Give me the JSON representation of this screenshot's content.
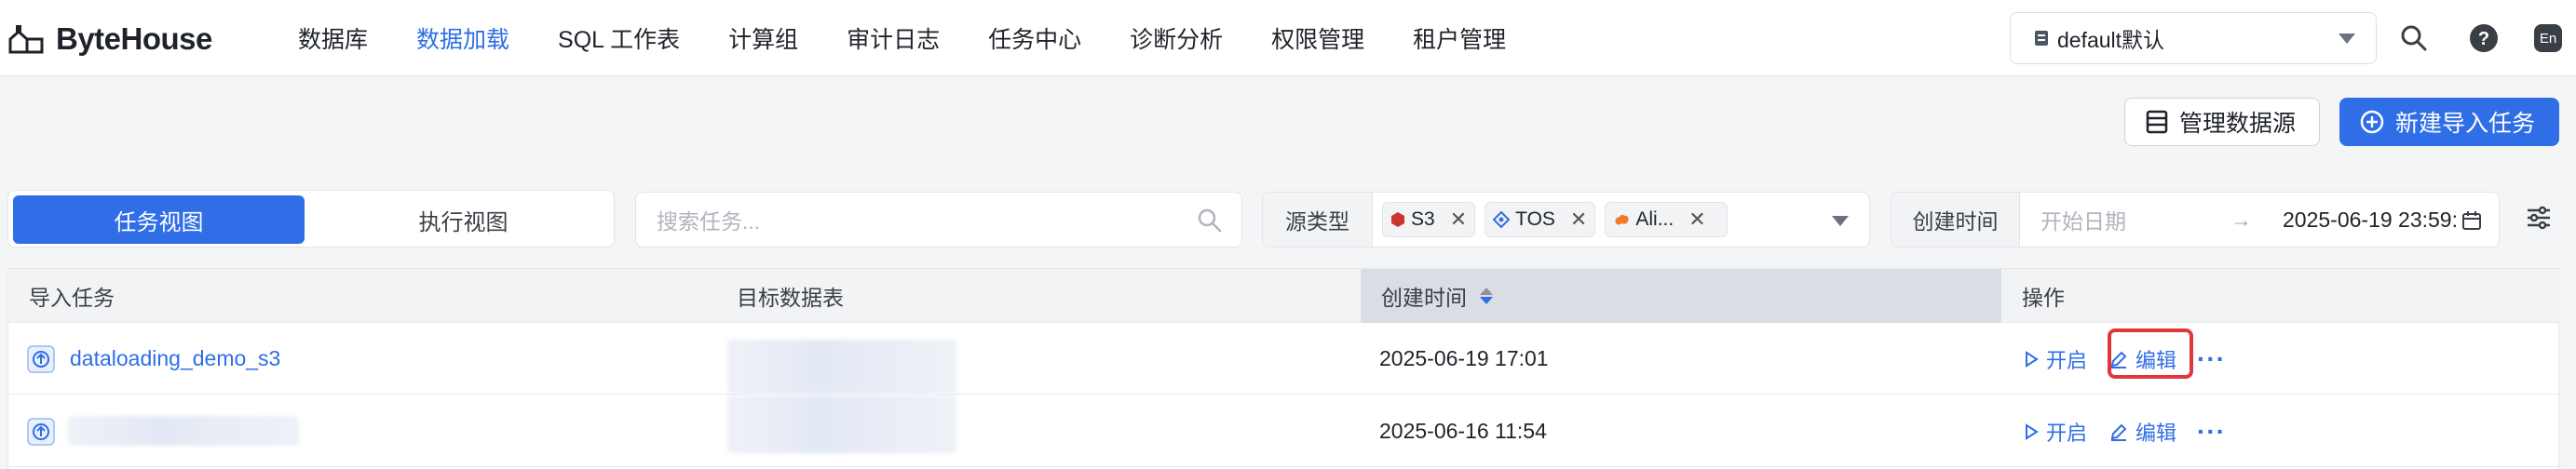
{
  "app": {
    "logo_text": "ByteHouse",
    "accent_color": "#2f6ee6"
  },
  "nav": {
    "items": [
      {
        "label": "数据库",
        "active": false
      },
      {
        "label": "数据加载",
        "active": true
      },
      {
        "label": "SQL 工作表",
        "active": false
      },
      {
        "label": "计算组",
        "active": false
      },
      {
        "label": "审计日志",
        "active": false
      },
      {
        "label": "任务中心",
        "active": false
      },
      {
        "label": "诊断分析",
        "active": false
      },
      {
        "label": "权限管理",
        "active": false
      },
      {
        "label": "租户管理",
        "active": false
      }
    ],
    "database_select": "default默认",
    "language": "En"
  },
  "toolbar": {
    "manage_label": "管理数据源",
    "new_label": "新建导入任务"
  },
  "filters": {
    "view_tabs": [
      "任务视图",
      "执行视图"
    ],
    "search_placeholder": "搜索任务...",
    "source_type_label": "源类型",
    "source_tags": [
      "S3",
      "TOS",
      "Ali..."
    ],
    "created_label": "创建时间",
    "start_placeholder": "开始日期",
    "arrow": "→",
    "end_value": "2025-06-19 23:59:"
  },
  "table": {
    "columns": [
      "导入任务",
      "目标数据表",
      "创建时间",
      "操作"
    ],
    "rows": [
      {
        "task": "dataloading_demo_s3",
        "created": "2025-06-19 17:01",
        "start": "开启",
        "edit": "编辑"
      },
      {
        "task": "",
        "created": "2025-06-16 11:54",
        "start": "开启",
        "edit": "编辑"
      }
    ]
  }
}
